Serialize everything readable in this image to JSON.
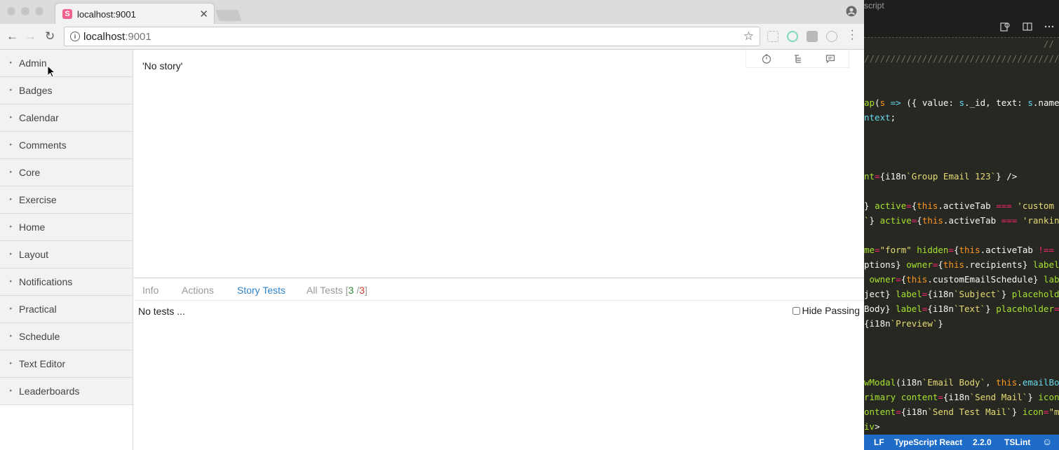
{
  "browser": {
    "tab_title": "localhost:9001",
    "favicon_letter": "S",
    "close_glyph": "✕",
    "url_host": "localhost",
    "url_port": ":9001",
    "back_glyph": "←",
    "forward_glyph": "→",
    "reload_glyph": "↻",
    "star_glyph": "☆",
    "info_glyph": "i"
  },
  "sidebar": {
    "arrow_glyph": "▸",
    "items": [
      {
        "label": "Admin"
      },
      {
        "label": "Badges"
      },
      {
        "label": "Calendar"
      },
      {
        "label": "Comments"
      },
      {
        "label": "Core"
      },
      {
        "label": "Exercise"
      },
      {
        "label": "Home"
      },
      {
        "label": "Layout"
      },
      {
        "label": "Notifications"
      },
      {
        "label": "Practical"
      },
      {
        "label": "Schedule"
      },
      {
        "label": "Text Editor"
      },
      {
        "label": "Leaderboards"
      }
    ]
  },
  "preview": {
    "message": "'No story'"
  },
  "panel": {
    "tabs": {
      "info": "Info",
      "actions": "Actions",
      "story_tests": "Story Tests",
      "all_tests": "All Tests",
      "open_bracket": "[",
      "passed": "3",
      "separator": " /",
      "total": "3",
      "close_bracket": "]"
    },
    "no_tests": "No tests ...",
    "hide_passing": "Hide Passing"
  },
  "vscode": {
    "title_fragment": "script",
    "code_lines": [
      {
        "segments": [
          {
            "c": "comment",
            "t": "                                  //"
          }
        ]
      },
      {
        "segments": [
          {
            "c": "comment",
            "t": "//////////////////////////////////////"
          }
        ]
      },
      {
        "segments": [
          {
            "c": "",
            "t": ""
          }
        ]
      },
      {
        "segments": [
          {
            "c": "",
            "t": ""
          }
        ]
      },
      {
        "segments": [
          {
            "c": "f",
            "t": "ap"
          },
          {
            "c": "",
            "t": "("
          },
          {
            "c": "p",
            "t": "s"
          },
          {
            "c": "",
            "t": " "
          },
          {
            "c": "v",
            "t": "=>"
          },
          {
            "c": "",
            "t": " ({ value: "
          },
          {
            "c": "v",
            "t": "s"
          },
          {
            "c": "",
            "t": "._id, text: "
          },
          {
            "c": "v",
            "t": "s"
          },
          {
            "c": "",
            "t": ".name"
          }
        ]
      },
      {
        "segments": [
          {
            "c": "v",
            "t": "ntext"
          },
          {
            "c": "",
            "t": ";"
          }
        ]
      },
      {
        "segments": [
          {
            "c": "",
            "t": ""
          }
        ]
      },
      {
        "segments": [
          {
            "c": "",
            "t": ""
          }
        ]
      },
      {
        "segments": [
          {
            "c": "",
            "t": ""
          }
        ]
      },
      {
        "segments": [
          {
            "c": "f",
            "t": "nt"
          },
          {
            "c": "k",
            "t": "="
          },
          {
            "c": "",
            "t": "{i18n"
          },
          {
            "c": "s",
            "t": "`Group Email 123`"
          },
          {
            "c": "",
            "t": "} />"
          }
        ]
      },
      {
        "segments": [
          {
            "c": "",
            "t": ""
          }
        ]
      },
      {
        "segments": [
          {
            "c": "",
            "t": "} "
          },
          {
            "c": "f",
            "t": "active"
          },
          {
            "c": "k",
            "t": "="
          },
          {
            "c": "",
            "t": "{"
          },
          {
            "c": "p",
            "t": "this"
          },
          {
            "c": "",
            "t": ".activeTab "
          },
          {
            "c": "k",
            "t": "==="
          },
          {
            "c": "",
            "t": " "
          },
          {
            "c": "s",
            "t": "'custom"
          }
        ]
      },
      {
        "segments": [
          {
            "c": "s",
            "t": "`"
          },
          {
            "c": "",
            "t": "} "
          },
          {
            "c": "f",
            "t": "active"
          },
          {
            "c": "k",
            "t": "="
          },
          {
            "c": "",
            "t": "{"
          },
          {
            "c": "p",
            "t": "this"
          },
          {
            "c": "",
            "t": ".activeTab "
          },
          {
            "c": "k",
            "t": "==="
          },
          {
            "c": "",
            "t": " "
          },
          {
            "c": "s",
            "t": "'rankin"
          }
        ]
      },
      {
        "segments": [
          {
            "c": "",
            "t": ""
          }
        ]
      },
      {
        "segments": [
          {
            "c": "f",
            "t": "me"
          },
          {
            "c": "k",
            "t": "="
          },
          {
            "c": "s",
            "t": "\"form\""
          },
          {
            "c": "",
            "t": " "
          },
          {
            "c": "f",
            "t": "hidden"
          },
          {
            "c": "k",
            "t": "="
          },
          {
            "c": "",
            "t": "{"
          },
          {
            "c": "p",
            "t": "this"
          },
          {
            "c": "",
            "t": ".activeTab "
          },
          {
            "c": "k",
            "t": "!=="
          }
        ]
      },
      {
        "segments": [
          {
            "c": "",
            "t": "ptions} "
          },
          {
            "c": "f",
            "t": "owner"
          },
          {
            "c": "k",
            "t": "="
          },
          {
            "c": "",
            "t": "{"
          },
          {
            "c": "p",
            "t": "this"
          },
          {
            "c": "",
            "t": ".recipients} "
          },
          {
            "c": "f",
            "t": "label"
          }
        ]
      },
      {
        "segments": [
          {
            "c": "",
            "t": " "
          },
          {
            "c": "f",
            "t": "owner"
          },
          {
            "c": "k",
            "t": "="
          },
          {
            "c": "",
            "t": "{"
          },
          {
            "c": "p",
            "t": "this"
          },
          {
            "c": "",
            "t": ".customEmailSchedule} "
          },
          {
            "c": "f",
            "t": "lab"
          }
        ]
      },
      {
        "segments": [
          {
            "c": "",
            "t": "ject} "
          },
          {
            "c": "f",
            "t": "label"
          },
          {
            "c": "k",
            "t": "="
          },
          {
            "c": "",
            "t": "{i18n"
          },
          {
            "c": "s",
            "t": "`Subject`"
          },
          {
            "c": "",
            "t": "} "
          },
          {
            "c": "f",
            "t": "placehold"
          }
        ]
      },
      {
        "segments": [
          {
            "c": "",
            "t": "Body} "
          },
          {
            "c": "f",
            "t": "label"
          },
          {
            "c": "k",
            "t": "="
          },
          {
            "c": "",
            "t": "{i18n"
          },
          {
            "c": "s",
            "t": "`Text`"
          },
          {
            "c": "",
            "t": "} "
          },
          {
            "c": "f",
            "t": "placeholder"
          },
          {
            "c": "k",
            "t": "="
          }
        ]
      },
      {
        "segments": [
          {
            "c": "",
            "t": "{i18n"
          },
          {
            "c": "s",
            "t": "`Preview`"
          },
          {
            "c": "",
            "t": "}"
          }
        ]
      },
      {
        "segments": [
          {
            "c": "",
            "t": ""
          }
        ]
      },
      {
        "segments": [
          {
            "c": "",
            "t": ""
          }
        ]
      },
      {
        "segments": [
          {
            "c": "",
            "t": ""
          }
        ]
      },
      {
        "segments": [
          {
            "c": "f",
            "t": "wModal"
          },
          {
            "c": "",
            "t": "(i18n"
          },
          {
            "c": "s",
            "t": "`Email Body`"
          },
          {
            "c": "",
            "t": ", "
          },
          {
            "c": "p",
            "t": "this"
          },
          {
            "c": "",
            "t": "."
          },
          {
            "c": "v",
            "t": "emailBo"
          }
        ]
      },
      {
        "segments": [
          {
            "c": "f",
            "t": "rimary"
          },
          {
            "c": "",
            "t": " "
          },
          {
            "c": "f",
            "t": "content"
          },
          {
            "c": "k",
            "t": "="
          },
          {
            "c": "",
            "t": "{i18n"
          },
          {
            "c": "s",
            "t": "`Send Mail`"
          },
          {
            "c": "",
            "t": "} "
          },
          {
            "c": "f",
            "t": "icon"
          }
        ]
      },
      {
        "segments": [
          {
            "c": "f",
            "t": "ontent"
          },
          {
            "c": "k",
            "t": "="
          },
          {
            "c": "",
            "t": "{i18n"
          },
          {
            "c": "s",
            "t": "`Send Test Mail`"
          },
          {
            "c": "",
            "t": "} "
          },
          {
            "c": "f",
            "t": "icon"
          },
          {
            "c": "k",
            "t": "="
          },
          {
            "c": "s",
            "t": "\"m"
          }
        ]
      },
      {
        "segments": [
          {
            "c": "f",
            "t": "iv"
          },
          {
            "c": "",
            "t": ">"
          }
        ]
      }
    ],
    "status": {
      "eol": "LF",
      "language": "TypeScript React",
      "version": "2.2.0",
      "linter": "TSLint",
      "smiley": "☺"
    }
  }
}
